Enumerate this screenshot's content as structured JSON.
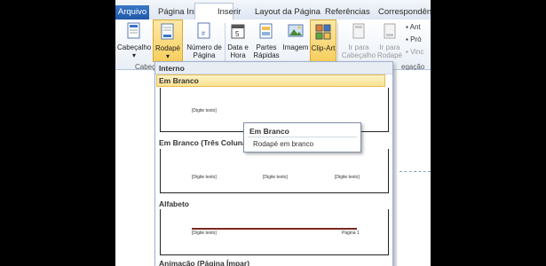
{
  "tabs": {
    "file": "Arquivo",
    "home": "Página Inicial",
    "insert": "Inserir",
    "layout": "Layout da Página",
    "references": "Referências",
    "mailings": "Correspondência"
  },
  "ribbon": {
    "header": "Cabeçalho",
    "footer": "Rodapé",
    "page_number_1": "Número de",
    "page_number_2": "Página",
    "datetime_1": "Data e",
    "datetime_2": "Hora",
    "quickparts_1": "Partes",
    "quickparts_2": "Rápidas",
    "picture": "Imagem",
    "clipart": "Clip-Art",
    "goto_header_1": "Ir para",
    "goto_header_2": "Cabeçalho",
    "goto_footer_1": "Ir para",
    "goto_footer_2": "Rodapé",
    "side_items": [
      "Ant",
      "Pró",
      "Vinc"
    ],
    "group_label_left": "Cabeç",
    "group_label_right": "egação"
  },
  "gallery": {
    "header": "Interno",
    "sections": [
      {
        "label": "Em Branco",
        "placeholders": [
          "[Digite texto]"
        ]
      },
      {
        "label": "Em Branco (Três Colunas)",
        "placeholders": [
          "[Digite texto]",
          "[Digite texto]",
          "[Digite texto]"
        ]
      },
      {
        "label": "Alfabeto",
        "placeholders": [
          "[Digite texto]",
          "Página 1"
        ]
      },
      {
        "label": "Animação (Página Ímpar)",
        "placeholders": []
      }
    ]
  },
  "tooltip": {
    "title": "Em Branco",
    "description": "Rodapé em branco"
  },
  "colors": {
    "file_tab": "#2a66b6",
    "active_highlight": "#f7cf5e",
    "ribbon_bg": "#e9eff7",
    "alphabet_rule": "#7a2a1e"
  }
}
